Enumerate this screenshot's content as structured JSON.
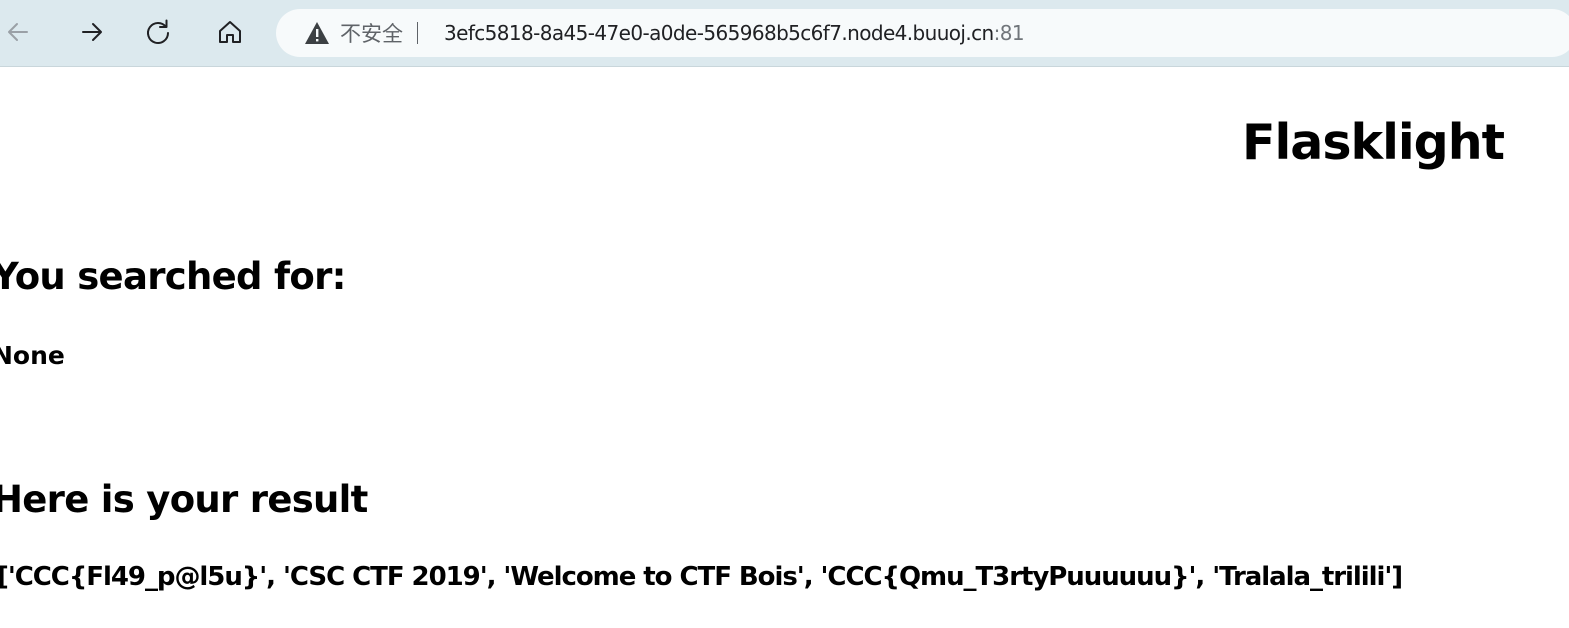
{
  "browser": {
    "security_label": "不安全",
    "url_host": "3efc5818-8a45-47e0-a0de-565968b5c6f7.node4.buuoj.cn",
    "url_port": ":81",
    "icons": {
      "back": "back-arrow-icon",
      "forward": "forward-arrow-icon",
      "reload": "reload-icon",
      "home": "home-icon",
      "warning": "warning-triangle-icon"
    }
  },
  "page": {
    "title": "Flasklight",
    "searched_heading": "You searched for:",
    "searched_value": "None",
    "result_heading": "Here is your result",
    "result_value": "['CCC{Fl49_p@l5u}', 'CSC CTF 2019', 'Welcome to CTF Bois', 'CCC{Qmu_T3rtyPuuuuuu}', 'Tralala_trilili']"
  }
}
